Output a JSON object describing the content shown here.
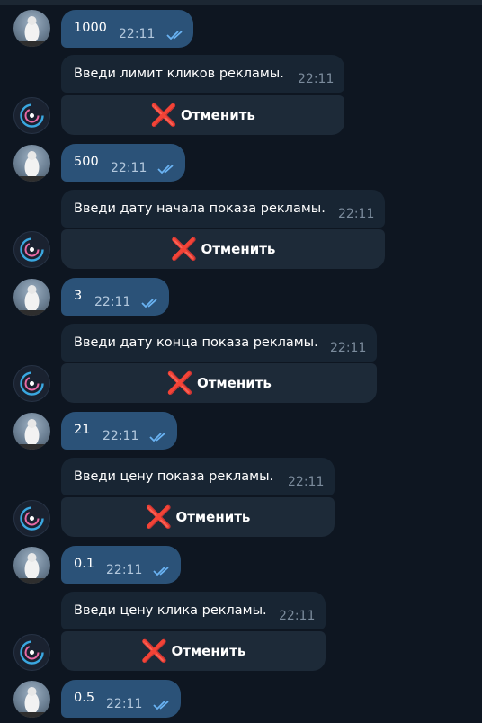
{
  "messages": [
    {
      "type": "out",
      "text": "1000",
      "time": "22:11"
    },
    {
      "type": "bot",
      "text": "Введи лимит кликов рекламы.",
      "time": "22:11",
      "button": {
        "icon": "❌",
        "label": "Отменить"
      }
    },
    {
      "type": "out",
      "text": "500",
      "time": "22:11"
    },
    {
      "type": "bot",
      "text": "Введи дату начала показа рекламы.",
      "time": "22:11",
      "button": {
        "icon": "❌",
        "label": "Отменить"
      }
    },
    {
      "type": "out",
      "text": "3",
      "time": "22:11"
    },
    {
      "type": "bot",
      "text": "Введи дату конца показа рекламы.",
      "time": "22:11",
      "button": {
        "icon": "❌",
        "label": "Отменить"
      }
    },
    {
      "type": "out",
      "text": "21",
      "time": "22:11"
    },
    {
      "type": "bot",
      "text": "Введи цену показа рекламы.",
      "time": "22:11",
      "button": {
        "icon": "❌",
        "label": "Отменить"
      }
    },
    {
      "type": "out",
      "text": "0.1",
      "time": "22:11"
    },
    {
      "type": "bot",
      "text": "Введи цену клика рекламы.",
      "time": "22:11",
      "button": {
        "icon": "❌",
        "label": "Отменить"
      }
    },
    {
      "type": "out",
      "text": "0.5",
      "time": "22:11"
    }
  ],
  "colors": {
    "background": "#0e1621",
    "outgoing_bubble": "#2b5278",
    "incoming_bubble": "#182533",
    "inline_button": "#1d2a38",
    "read_ticks": "#6ab3f3",
    "cancel_icon": "#e0211f"
  },
  "icons": {
    "user_avatar": "penguin-avatar-icon",
    "bot_avatar": "bot-logo-icon",
    "read_status": "double-check-icon",
    "cancel": "cross-mark-icon"
  }
}
